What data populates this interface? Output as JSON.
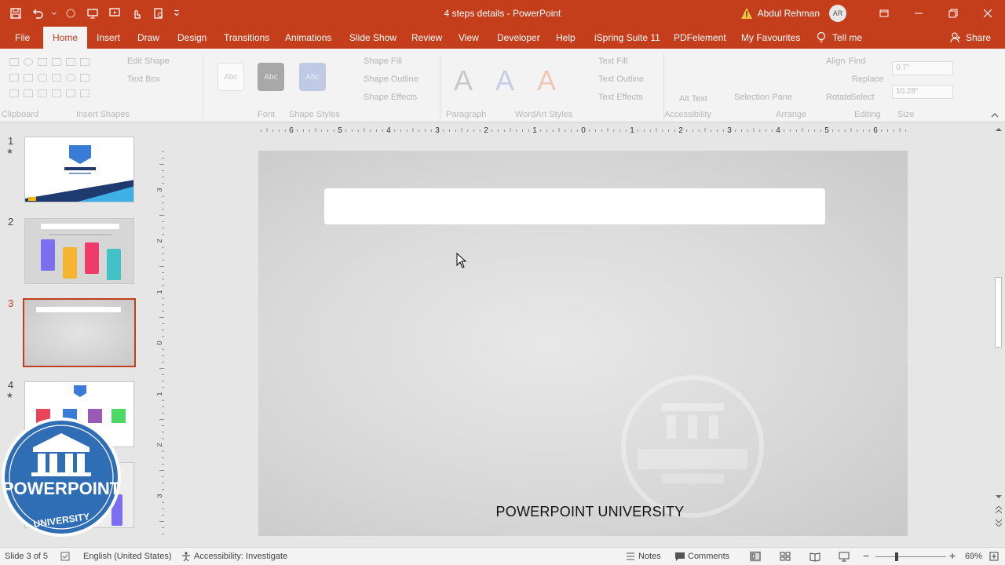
{
  "window": {
    "title": "4 steps details  -  PowerPoint",
    "user_name": "Abdul Rehman",
    "user_initials": "AR"
  },
  "ribbon_tabs": [
    "File",
    "Home",
    "Insert",
    "Draw",
    "Design",
    "Transitions",
    "Animations",
    "Slide Show",
    "Review",
    "View",
    "Developer",
    "Help",
    "iSpring Suite 11",
    "PDFelement",
    "My Favourites"
  ],
  "active_tab": "Home",
  "tell_me": "Tell me",
  "share": "Share",
  "ribbon": {
    "edit_shape": "Edit Shape",
    "text_box": "Text Box",
    "shape_fill": "Shape Fill",
    "shape_outline": "Shape Outline",
    "shape_effects": "Shape Effects",
    "style_sample": "Abc",
    "text_fill": "Text Fill",
    "text_outline": "Text Outline",
    "text_effects": "Text Effects",
    "alt_text": "Alt Text",
    "selection_pane": "Selection Pane",
    "align": "Align",
    "rotate": "Rotate",
    "find": "Find",
    "replace": "Replace",
    "select": "Select",
    "height_value": "0.7\"",
    "width_value": "10.28\"",
    "wordart_letter": "A",
    "groups": {
      "clipboard": "Clipboard",
      "insert_shapes": "Insert Shapes",
      "font": "Font",
      "shape_styles": "Shape Styles",
      "paragraph": "Paragraph",
      "wordart_styles": "WordArt Styles",
      "accessibility": "Accessibility",
      "arrange": "Arrange",
      "editing": "Editing",
      "size": "Size"
    }
  },
  "slides": [
    {
      "number": "1",
      "star": true
    },
    {
      "number": "2",
      "star": false
    },
    {
      "number": "3",
      "star": false,
      "selected": true
    },
    {
      "number": "4",
      "star": true
    }
  ],
  "ruler": {
    "horizontal": [
      "6",
      "5",
      "4",
      "3",
      "2",
      "1",
      "0",
      "1",
      "2",
      "3",
      "4",
      "5",
      "6"
    ],
    "vertical": [
      "3",
      "2",
      "1",
      "0",
      "1",
      "2",
      "3"
    ]
  },
  "slide": {
    "footer_text": "POWERPOINT UNIVERSITY"
  },
  "logo": {
    "line1": "POWERPOINT",
    "line2": "UNIVERSITY"
  },
  "status": {
    "slide_of": "Slide 3 of 5",
    "language": "English (United States)",
    "accessibility": "Accessibility: Investigate",
    "notes": "Notes",
    "comments": "Comments",
    "zoom": "69%"
  },
  "colors": {
    "accent": "#c43e1c",
    "logo_blue": "#2f6db5"
  }
}
